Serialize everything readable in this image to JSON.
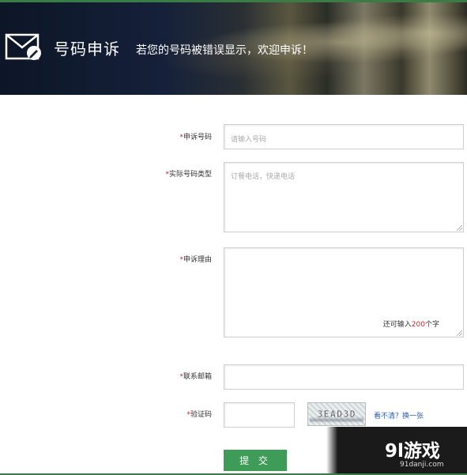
{
  "banner": {
    "title": "号码申诉",
    "subtitle": "若您的号码被错误显示，欢迎申诉！"
  },
  "form": {
    "required_mark": "*",
    "number": {
      "label": "申诉号码",
      "placeholder": "请输入号码"
    },
    "actual_type": {
      "label": "实际号码类型",
      "placeholder": "订餐电话，快递电话"
    },
    "reason": {
      "label": "申诉理由",
      "counter_prefix": "还可输入",
      "counter_value": "200",
      "counter_suffix": "个字"
    },
    "email": {
      "label": "联系邮箱"
    },
    "captcha": {
      "label": "验证码",
      "image_text": "3EAD3D",
      "refresh_link": "看不清？换一张"
    },
    "submit_label": "提 交"
  },
  "watermark": {
    "main": "9l游戏",
    "url": "91danji.com"
  },
  "colors": {
    "required": "#d2232a",
    "submit": "#3f9c58",
    "link": "#2a5db0"
  }
}
